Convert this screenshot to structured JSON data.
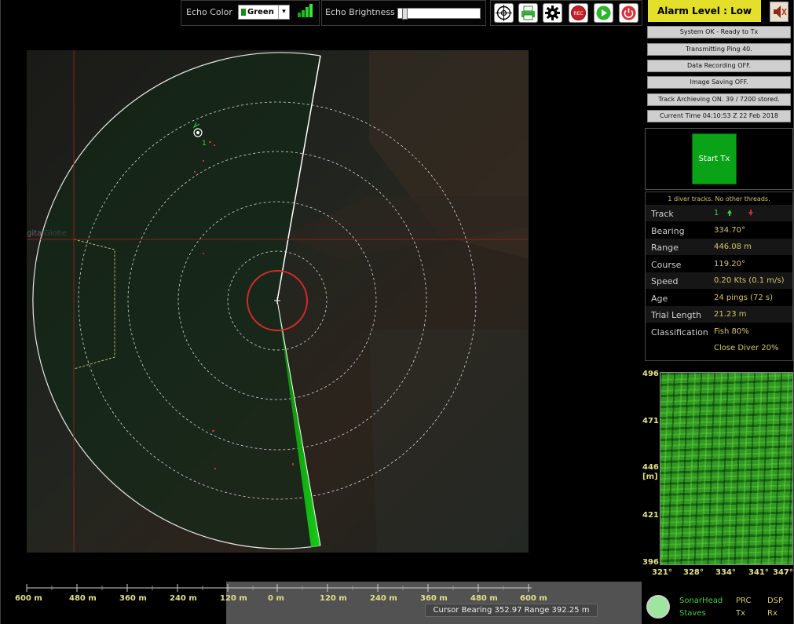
{
  "toolbar": {
    "echo_color_label": "Echo Color",
    "echo_color_value": "Green",
    "echo_brightness_label": "Echo Brightness",
    "echo_brightness_level": 0.02,
    "tools": [
      "target-icon",
      "printer-icon",
      "settings-gear-icon",
      "record-icon",
      "play-icon",
      "power-icon"
    ]
  },
  "alarm": {
    "label": "Alarm Level : Low",
    "color": "#e3df2b"
  },
  "status": [
    "System OK - Ready to Tx",
    "Transmitting Ping 40.",
    "Data Recording OFF.",
    "Image Saving OFF.",
    "Track Archieving ON. 39 / 7200 stored.",
    "Current Time  04:10:53 Z  22 Feb 2018"
  ],
  "start_tx_label": "Start Tx",
  "track_info": {
    "header": "1 diver tracks.  No other threads.",
    "rows": [
      {
        "key": "Track",
        "value": "1"
      },
      {
        "key": "Bearing",
        "value": "334.70°"
      },
      {
        "key": "Range",
        "value": "446.08  m"
      },
      {
        "key": "Course",
        "value": "119.20°"
      },
      {
        "key": "Speed",
        "value": "0.20 Kts (0.1  m/s)"
      },
      {
        "key": "Age",
        "value": "24  pings (72  s)"
      },
      {
        "key": "Trial Length",
        "value": "21.23  m"
      },
      {
        "key": "Classification",
        "value": "Fish  80%"
      }
    ],
    "classification_second": "Close Diver  20%"
  },
  "sonar": {
    "map_watermark": "gitalGlobe",
    "track_id_label": "1"
  },
  "waterfall": {
    "y_ticks": [
      "496",
      "471",
      "446",
      "421",
      "396"
    ],
    "y_unit": "[m]",
    "x_ticks": [
      "321°",
      "328°",
      "334°",
      "341°",
      "347°"
    ]
  },
  "range_scale": [
    "600 m",
    "480 m",
    "360 m",
    "240 m",
    "120 m",
    "0 m",
    "120 m",
    "240 m",
    "360 m",
    "480 m",
    "600 m"
  ],
  "cursor_readout": "Cursor  Bearing 352.97    Range  392.25  m",
  "hardware": {
    "sonarhead": "SonarHead",
    "staves": "Staves",
    "prc": "PRC",
    "tx": "Tx",
    "dsp": "DSP",
    "rx": "Rx"
  }
}
